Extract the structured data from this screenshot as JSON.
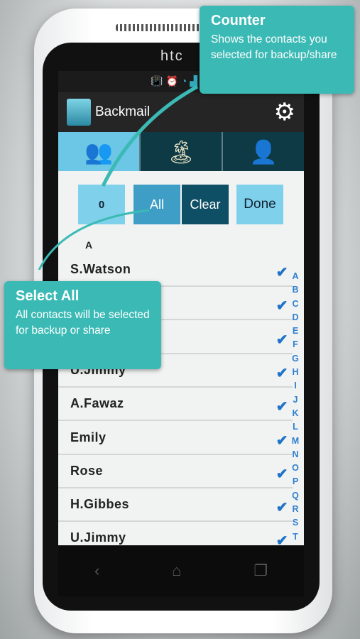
{
  "device": {
    "brand": "htc"
  },
  "status_bar": {
    "icons": [
      "vibrate-icon",
      "alarm-icon",
      "wifi-icon",
      "signal-icon"
    ]
  },
  "app": {
    "title": "Backmail",
    "settings_icon": "gear-icon"
  },
  "tabs": [
    {
      "icon": "contacts-group-icon",
      "active": true
    },
    {
      "icon": "gallery-icon",
      "active": false
    },
    {
      "icon": "profile-icon",
      "active": false
    }
  ],
  "buttons": {
    "counter": "0",
    "all": "All",
    "clear": "Clear",
    "done": "Done"
  },
  "list": {
    "section": "A",
    "rows": [
      {
        "name": "S.Watson",
        "checked": true
      },
      {
        "name": "",
        "checked": true
      },
      {
        "name": "",
        "checked": true
      },
      {
        "name": "U.Jimmy",
        "checked": true
      },
      {
        "name": "A.Fawaz",
        "checked": true
      },
      {
        "name": "Emily",
        "checked": true
      },
      {
        "name": "Rose",
        "checked": true
      },
      {
        "name": "H.Gibbes",
        "checked": true
      },
      {
        "name": "U.Jimmy",
        "checked": true
      }
    ]
  },
  "index_letters": [
    "A",
    "B",
    "C",
    "D",
    "E",
    "F",
    "G",
    "H",
    "I",
    "J",
    "K",
    "L",
    "M",
    "N",
    "O",
    "P",
    "Q",
    "R",
    "S",
    "T"
  ],
  "callouts": {
    "counter": {
      "title": "Counter",
      "text": "Shows the contacts you selected for backup/share"
    },
    "select_all": {
      "title": "Select All",
      "text": "All contacts will be selected for backup or share"
    }
  },
  "colors": {
    "accent": "#3bbab5",
    "tab_active": "#6cc6e6",
    "check": "#1f73c8"
  }
}
